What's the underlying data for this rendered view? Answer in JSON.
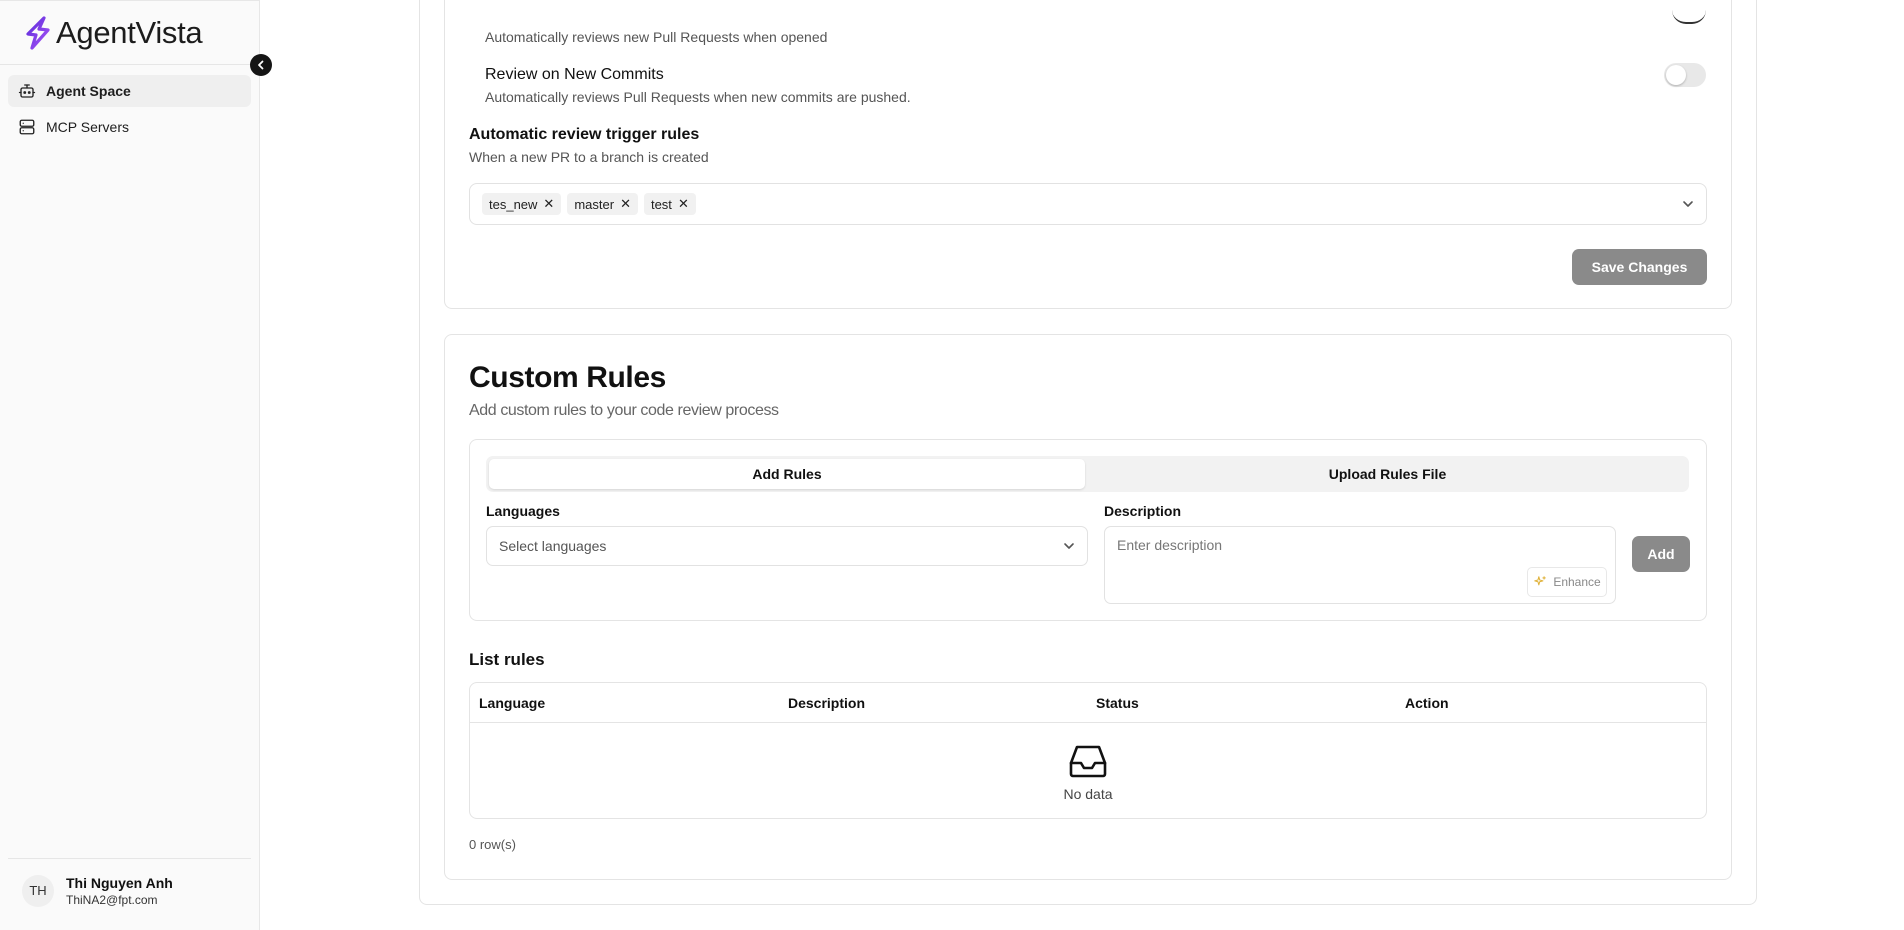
{
  "app": {
    "name": "AgentVista"
  },
  "sidebar": {
    "items": [
      {
        "label": "Agent Space",
        "icon": "bot-icon",
        "active": true
      },
      {
        "label": "MCP Servers",
        "icon": "server-icon",
        "active": false
      }
    ],
    "user": {
      "initials": "TH",
      "name": "Thi Nguyen Anh",
      "email": "ThiNA2@fpt.com"
    }
  },
  "review_settings": {
    "toggles": [
      {
        "title": "",
        "description": "Automatically reviews new Pull Requests when opened",
        "on": true
      },
      {
        "title": "Review on New Commits",
        "description": "Automatically reviews Pull Requests when new commits are pushed.",
        "on": false
      }
    ],
    "trigger_rules": {
      "title": "Automatic review trigger rules",
      "subtitle": "When a new PR to a branch is created",
      "tags": [
        "tes_new",
        "master",
        "test"
      ]
    },
    "save_label": "Save Changes"
  },
  "custom_rules": {
    "title": "Custom Rules",
    "subtitle": "Add custom rules to your code review process",
    "tabs": [
      {
        "label": "Add Rules",
        "active": true
      },
      {
        "label": "Upload Rules File",
        "active": false
      }
    ],
    "languages_label": "Languages",
    "languages_placeholder": "Select languages",
    "description_label": "Description",
    "description_placeholder": "Enter description",
    "enhance_label": "Enhance",
    "add_label": "Add",
    "list_title": "List rules",
    "table": {
      "columns": [
        "Language",
        "Description",
        "Status",
        "Action"
      ],
      "rows": [],
      "empty_text": "No data"
    },
    "row_count": "0 row(s)"
  },
  "colors": {
    "accent": "#7c3aed",
    "button_gray": "#8a8a8a",
    "border": "#e4e4e4"
  }
}
